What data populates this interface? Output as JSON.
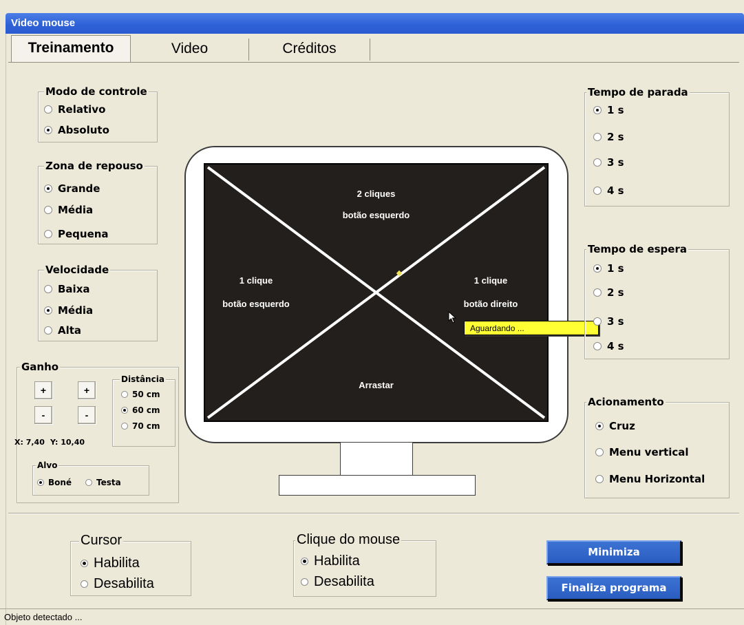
{
  "window": {
    "title": "Video mouse"
  },
  "tabs": [
    "Treinamento",
    "Video",
    "Créditos"
  ],
  "modo_controle": {
    "title": "Modo de controle",
    "options": [
      "Relativo",
      "Absoluto"
    ],
    "selected": "Absoluto"
  },
  "zona_repouso": {
    "title": "Zona de repouso",
    "options": [
      "Grande",
      "Média",
      "Pequena"
    ],
    "selected": "Grande"
  },
  "velocidade": {
    "title": "Velocidade",
    "options": [
      "Baixa",
      "Média",
      "Alta"
    ],
    "selected": "Média"
  },
  "ganho": {
    "title": "Ganho",
    "plus": "+",
    "minus": "-",
    "coords": {
      "x": "X: 7,40",
      "y": "Y: 10,40"
    },
    "distancia": {
      "title": "Distância",
      "options": [
        "50 cm",
        "60 cm",
        "70 cm"
      ],
      "selected": "60 cm"
    },
    "alvo": {
      "title": "Alvo",
      "options": [
        "Boné",
        "Testa"
      ],
      "selected": "Boné"
    }
  },
  "tempo_parada": {
    "title": "Tempo de parada",
    "options": [
      "1 s",
      "2 s",
      "3 s",
      "4 s"
    ],
    "selected": "1 s"
  },
  "tempo_espera": {
    "title": "Tempo de espera",
    "options": [
      "1 s",
      "2 s",
      "3 s",
      "4 s"
    ],
    "selected": "1 s"
  },
  "acionamento": {
    "title": "Acionamento",
    "options": [
      "Cruz",
      "Menu vertical",
      "Menu Horizontal"
    ],
    "selected": "Cruz"
  },
  "screen": {
    "top": [
      "2 cliques",
      "botão esquerdo"
    ],
    "left": [
      "1 clique",
      "botão esquerdo"
    ],
    "right": [
      "1 clique",
      "botão direito"
    ],
    "bottom": "Arrastar",
    "tooltip": "Aguardando ..."
  },
  "cursor": {
    "title": "Cursor",
    "options": [
      "Habilita",
      "Desabilita"
    ],
    "selected": "Habilita"
  },
  "clique_mouse": {
    "title": "Clique do mouse",
    "options": [
      "Habilita",
      "Desabilita"
    ],
    "selected": "Habilita"
  },
  "buttons": {
    "minimiza": "Minimiza",
    "finaliza": "Finaliza programa"
  },
  "status": "Objeto detectado ...",
  "colors": {
    "titlebar": "#2f62d6",
    "screen": "#231f1c",
    "tooltip": "#ffff33",
    "button": "#3266c9"
  }
}
